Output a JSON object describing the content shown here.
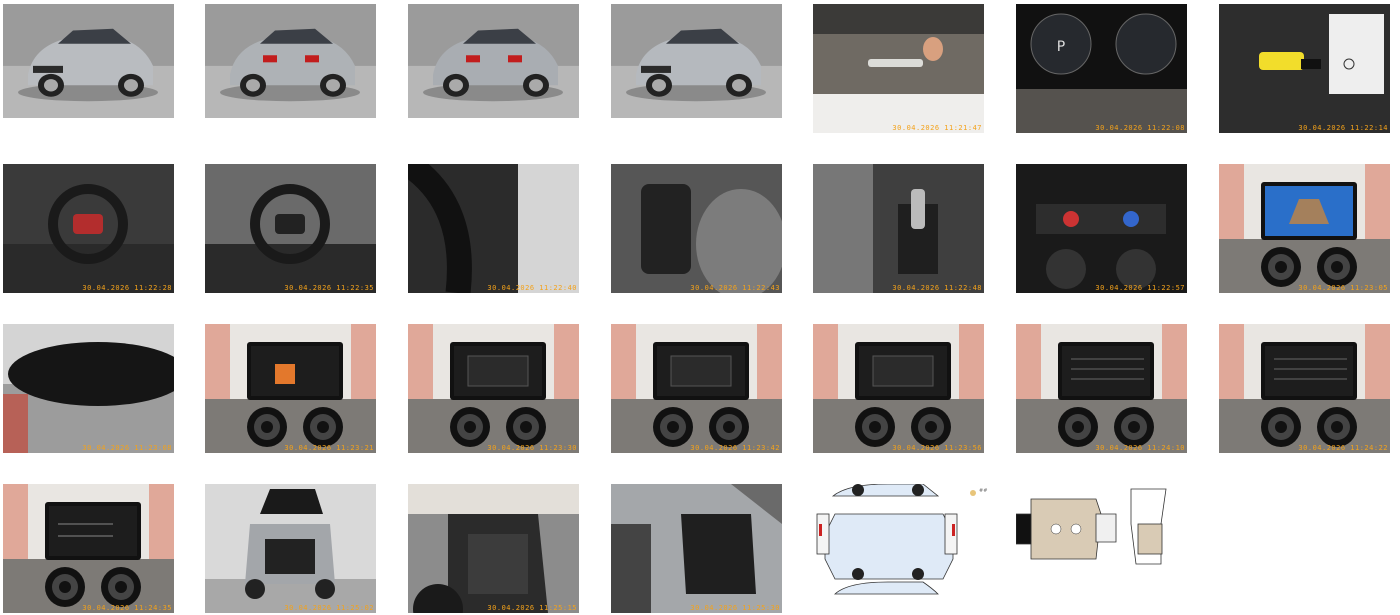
{
  "gallery": {
    "photos": [
      {
        "scene": "car-exterior-front-left",
        "timestamp": ""
      },
      {
        "scene": "car-exterior-rear-left",
        "timestamp": ""
      },
      {
        "scene": "car-exterior-rear-right",
        "timestamp": ""
      },
      {
        "scene": "car-exterior-front-right",
        "timestamp": ""
      },
      {
        "scene": "windshield",
        "timestamp": "30.04.2026 11:21:47"
      },
      {
        "scene": "instrument-cluster",
        "timestamp": "30.04.2026 11:22:08"
      },
      {
        "scene": "key-and-manual",
        "timestamp": "30.04.2026 11:22:14"
      },
      {
        "scene": "instrument-cluster-on",
        "timestamp": "30.04.2026 11:22:28"
      },
      {
        "scene": "steering-wheel",
        "timestamp": "30.04.2026 11:22:35"
      },
      {
        "scene": "steering-column-stalk",
        "timestamp": "30.04.2026 11:22:40"
      },
      {
        "scene": "door-panel-switches",
        "timestamp": "30.04.2026 11:22:43"
      },
      {
        "scene": "gear-selector",
        "timestamp": "30.04.2026 11:22:48"
      },
      {
        "scene": "climate-controls",
        "timestamp": "30.04.2026 11:22:57"
      },
      {
        "scene": "infotainment-rear-camera",
        "timestamp": "30.04.2026 11:23:05"
      },
      {
        "scene": "rear-view-mirror",
        "timestamp": "30.04.2026 11:23:08"
      },
      {
        "scene": "infotainment-menu",
        "timestamp": "30.04.2026 11:23:21"
      },
      {
        "scene": "infotainment-dialog",
        "timestamp": "30.04.2026 11:23:30"
      },
      {
        "scene": "infotainment-dialog",
        "timestamp": "30.04.2026 11:23:42"
      },
      {
        "scene": "infotainment-dialog",
        "timestamp": "30.04.2026 11:23:56"
      },
      {
        "scene": "infotainment-list",
        "timestamp": "30.04.2026 11:24:10"
      },
      {
        "scene": "infotainment-list",
        "timestamp": "30.04.2026 11:24:22"
      },
      {
        "scene": "infotainment-info",
        "timestamp": "30.04.2026 11:24:35"
      },
      {
        "scene": "trunk-open",
        "timestamp": "30.04.2026 11:25:02"
      },
      {
        "scene": "rear-seats",
        "timestamp": "30.04.2026 11:25:15"
      },
      {
        "scene": "front-seats",
        "timestamp": "30.04.2026 11:25:30"
      },
      {
        "scene": "damage-diagram-exterior",
        "timestamp": ""
      },
      {
        "scene": "damage-diagram-interior",
        "timestamp": ""
      }
    ],
    "legend_label": "##"
  }
}
